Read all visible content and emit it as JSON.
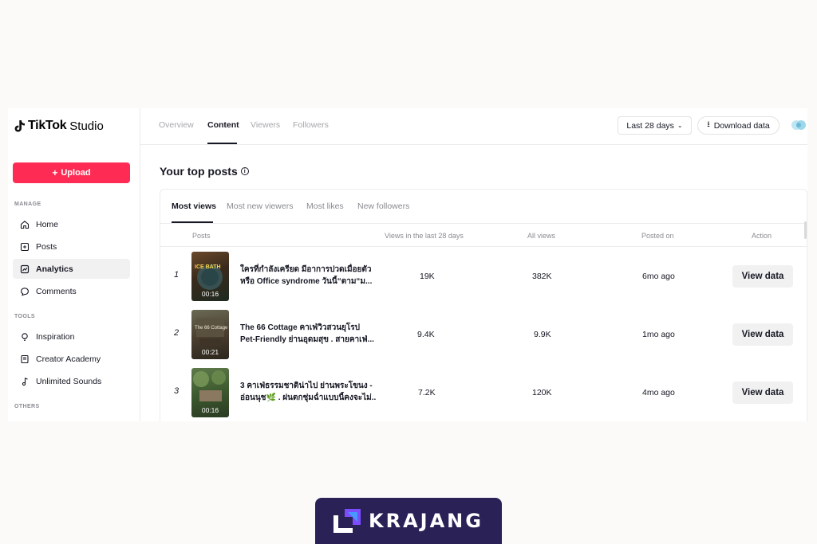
{
  "app": {
    "logo_brand": "TikTok",
    "logo_product": "Studio"
  },
  "sidebar": {
    "upload_label": "Upload",
    "sections": {
      "manage": "MANAGE",
      "tools": "TOOLS",
      "others": "OTHERS"
    },
    "items": [
      {
        "label": "Home",
        "icon": "home-icon"
      },
      {
        "label": "Posts",
        "icon": "posts-icon"
      },
      {
        "label": "Analytics",
        "icon": "analytics-icon",
        "active": true
      },
      {
        "label": "Comments",
        "icon": "comments-icon"
      },
      {
        "label": "Inspiration",
        "icon": "lightbulb-icon"
      },
      {
        "label": "Creator Academy",
        "icon": "book-icon"
      },
      {
        "label": "Unlimited Sounds",
        "icon": "music-note-icon"
      }
    ]
  },
  "topbar": {
    "tabs": [
      {
        "label": "Overview"
      },
      {
        "label": "Content",
        "active": true
      },
      {
        "label": "Viewers"
      },
      {
        "label": "Followers"
      }
    ],
    "date_range": "Last 28 days",
    "download_label": "Download data"
  },
  "main": {
    "title": "Your top posts",
    "subtabs": [
      {
        "label": "Most views",
        "active": true
      },
      {
        "label": "Most new viewers"
      },
      {
        "label": "Most likes"
      },
      {
        "label": "New followers"
      }
    ],
    "columns": [
      "Posts",
      "Views in the last 28 days",
      "All views",
      "Posted on",
      "Action"
    ],
    "rows": [
      {
        "rank": "1",
        "title_line1": "ใครที่กำลังเครียด มีอาการปวดเมื่อยตัว",
        "title_line2": "หรือ Office syndrome วันนี้“ตาม“ม...",
        "thumb_text": "ICE BATH",
        "duration": "00:16",
        "views_28d": "19K",
        "all_views": "382K",
        "posted": "6mo ago",
        "action": "View data"
      },
      {
        "rank": "2",
        "title_line1": "The 66 Cottage คาเฟ่วิวสวนยุโรป",
        "title_line2": "Pet-Friendly ย่านอุดมสุข . สายคาเฟ่...",
        "thumb_text": "The 66 Cottage",
        "duration": "00:21",
        "views_28d": "9.4K",
        "all_views": "9.9K",
        "posted": "1mo ago",
        "action": "View data"
      },
      {
        "rank": "3",
        "title_line1": "3 คาเฟ่ธรรมชาติน่าไป ย่านพระโขนง -",
        "title_line2": "อ่อนนุช🌿 . ฝนตกชุ่มฉ่ำแบบนี้คงจะไม่...",
        "thumb_text": "",
        "duration": "00:16",
        "views_28d": "7.2K",
        "all_views": "120K",
        "posted": "4mo ago",
        "action": "View data"
      }
    ]
  },
  "footer": {
    "brand_text": "KRAJANG"
  },
  "colors": {
    "accent": "#fe2c55",
    "brand_bg": "#2a2257"
  }
}
